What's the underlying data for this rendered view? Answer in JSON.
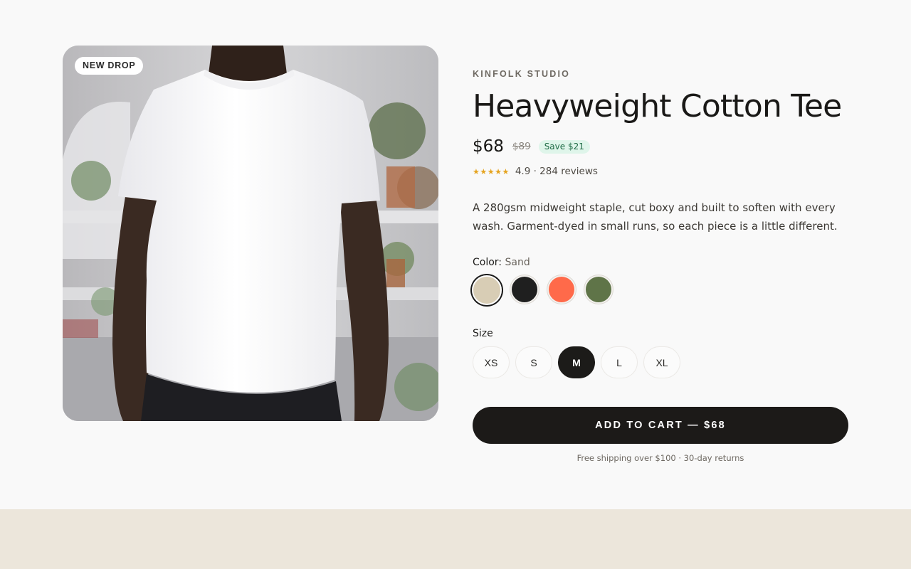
{
  "product": {
    "badge": "NEW DROP",
    "brand": "KINFOLK STUDIO",
    "title": "Heavyweight Cotton Tee",
    "price": "$68",
    "old_price": "$89",
    "save_label": "Save $21",
    "rating": {
      "stars": "★★★★★",
      "text": "4.9 · 284 reviews"
    },
    "description": "A 280gsm midweight staple, cut boxy and built to soften with every wash. Garment-dyed in small runs, so each piece is a little different."
  },
  "color": {
    "label": "Color:",
    "selected": "Sand",
    "options": [
      {
        "name": "Sand",
        "hex": "#d8cdb5"
      },
      {
        "name": "Black",
        "hex": "#1f1f1f"
      },
      {
        "name": "Coral",
        "hex": "#ff6a4a"
      },
      {
        "name": "Olive",
        "hex": "#5f7448"
      }
    ]
  },
  "size": {
    "label": "Size",
    "options": [
      "XS",
      "S",
      "M",
      "L",
      "XL"
    ],
    "selected": "M"
  },
  "cart": {
    "button_label": "ADD TO CART — $68",
    "shipping_note": "Free shipping over $100 · 30-day returns"
  },
  "colors": {
    "background": "#f9f9f9",
    "bottom_band": "#ece6db",
    "primary": "#1c1a18",
    "star": "#e5a420",
    "save_bg": "#dff5ea",
    "save_text": "#1f6b45"
  }
}
